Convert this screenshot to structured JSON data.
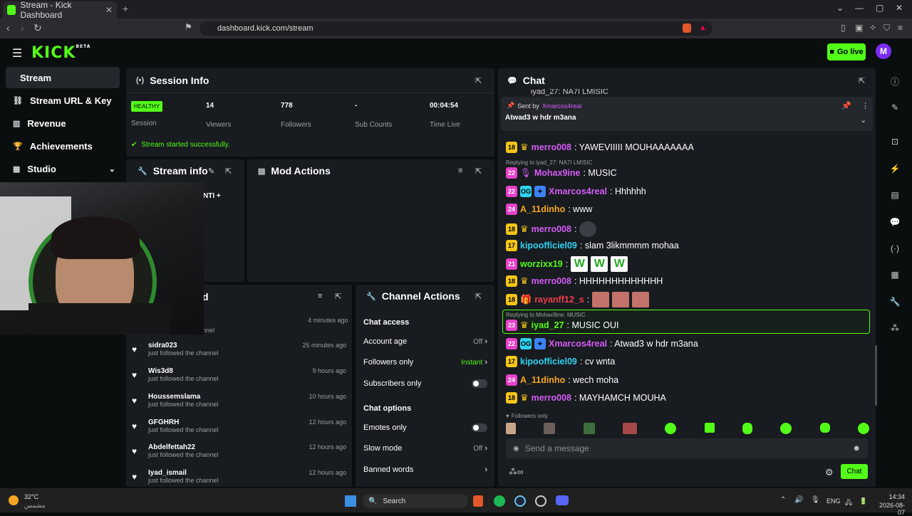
{
  "browser": {
    "tab_title": "Stream - Kick Dashboard",
    "url": "dashboard.kick.com/stream"
  },
  "header": {
    "logo": "KICK",
    "logo_badge": "BETA",
    "go_live": "Go live",
    "avatar": "M"
  },
  "sidebar": {
    "items": [
      {
        "label": "Stream"
      },
      {
        "label": "Stream URL & Key"
      },
      {
        "label": "Revenue"
      },
      {
        "label": "Achievements"
      },
      {
        "label": "Studio"
      }
    ]
  },
  "session": {
    "title": "Session Info",
    "status": "HEALTHY",
    "status_label": "Session",
    "stats": [
      {
        "value": "14",
        "label": "Viewers"
      },
      {
        "value": "778",
        "label": "Followers"
      },
      {
        "value": "-",
        "label": "Sub Counts"
      },
      {
        "value": "00:04:54",
        "label": "Time Live"
      }
    ],
    "message": "Stream started successfully."
  },
  "stream_info": {
    "title": "Stream info",
    "partial": "NTI +"
  },
  "mod_actions": {
    "title": "Mod Actions"
  },
  "recent": {
    "title_partial": "d",
    "first_time": "4 minutes ago",
    "first_sub": "nnel",
    "items": [
      {
        "name": "sidra023",
        "sub": "just followed the channel",
        "time": "25 minutes ago"
      },
      {
        "name": "Wis3d8",
        "sub": "just followed the channel",
        "time": "9 hours ago"
      },
      {
        "name": "Houssemslama",
        "sub": "just followed the channel",
        "time": "10 hours ago"
      },
      {
        "name": "GFGHRH",
        "sub": "just followed the channel",
        "time": "12 hours ago"
      },
      {
        "name": "Abdelfettah22",
        "sub": "just followed the channel",
        "time": "12 hours ago"
      },
      {
        "name": "Iyad_ismail",
        "sub": "just followed the channel",
        "time": "12 hours ago"
      }
    ]
  },
  "channel_actions": {
    "title": "Channel Actions",
    "chat_access": "Chat access",
    "account_age": "Account age",
    "account_age_val": "Off",
    "followers_only": "Followers only",
    "followers_only_val": "Instant",
    "subscribers_only": "Subscribers only",
    "chat_options": "Chat options",
    "emotes_only": "Emotes only",
    "slow_mode": "Slow mode",
    "slow_mode_val": "Off",
    "banned_words": "Banned words"
  },
  "chat": {
    "title": "Chat",
    "top_partial": "iyad_27: NA7I LMISIC",
    "pinned_by": "Sent by",
    "pinned_user": "Xmarcos4real",
    "pinned_msg": "Atwad3 w hdr m3ana",
    "messages": [
      {
        "badge": "18",
        "user": "merro008",
        "color": "#d35cf5",
        "text": ": YAWEVIIIII MOUHAAAAAAA"
      },
      {
        "reply": "Replying to iyad_27: NA7I LMISIC",
        "badge": "22",
        "user": "Mohax9ine",
        "color": "#d35cf5",
        "text": ": MUSIC"
      },
      {
        "badge": "22",
        "user": "Xmarcos4real",
        "color": "#d35cf5",
        "text": ": Hhhhhh"
      },
      {
        "badge": "24",
        "user": "A_11dinho",
        "color": "#f5a623",
        "text": ": www"
      },
      {
        "badge": "18",
        "user": "merro008",
        "color": "#d35cf5",
        "text": ":"
      },
      {
        "badge": "17",
        "user": "kipoofficiel09",
        "color": "#2ed3f0",
        "text": ": slam 3likmmmm mohaa"
      },
      {
        "badge": "21",
        "user": "worzixx19",
        "color": "#53fc18",
        "text": ":"
      },
      {
        "badge": "18",
        "user": "merro008",
        "color": "#d35cf5",
        "text": ": HHHHHHHHHHHHH"
      },
      {
        "badge": "18",
        "user": "rayanff12_s",
        "color": "#f03c4b",
        "text": ":"
      },
      {
        "reply": "Replying to Mohax9ine: MUSIC",
        "badge": "23",
        "user": "iyad_27",
        "color": "#53fc18",
        "text": ": MUSIC OUI"
      },
      {
        "badge": "22",
        "user": "Xmarcos4real",
        "color": "#d35cf5",
        "text": ": Atwad3 w hdr m3ana"
      },
      {
        "badge": "17",
        "user": "kipoofficiel09",
        "color": "#2ed3f0",
        "text": ": cv wnta"
      },
      {
        "badge": "24",
        "user": "A_11dinho",
        "color": "#f5a623",
        "text": ": wech moha"
      },
      {
        "badge": "18",
        "user": "merro008",
        "color": "#d35cf5",
        "text": ": MAYHAMCH MOUHA"
      }
    ],
    "followers_only": "Followers only",
    "placeholder": "Send a message",
    "send": "Chat",
    "w": "W"
  },
  "taskbar": {
    "temp": "32°C",
    "weather": "مشمس",
    "search": "Search",
    "lang": "ENG",
    "time": "14:34",
    "date": "2026-08-07"
  }
}
